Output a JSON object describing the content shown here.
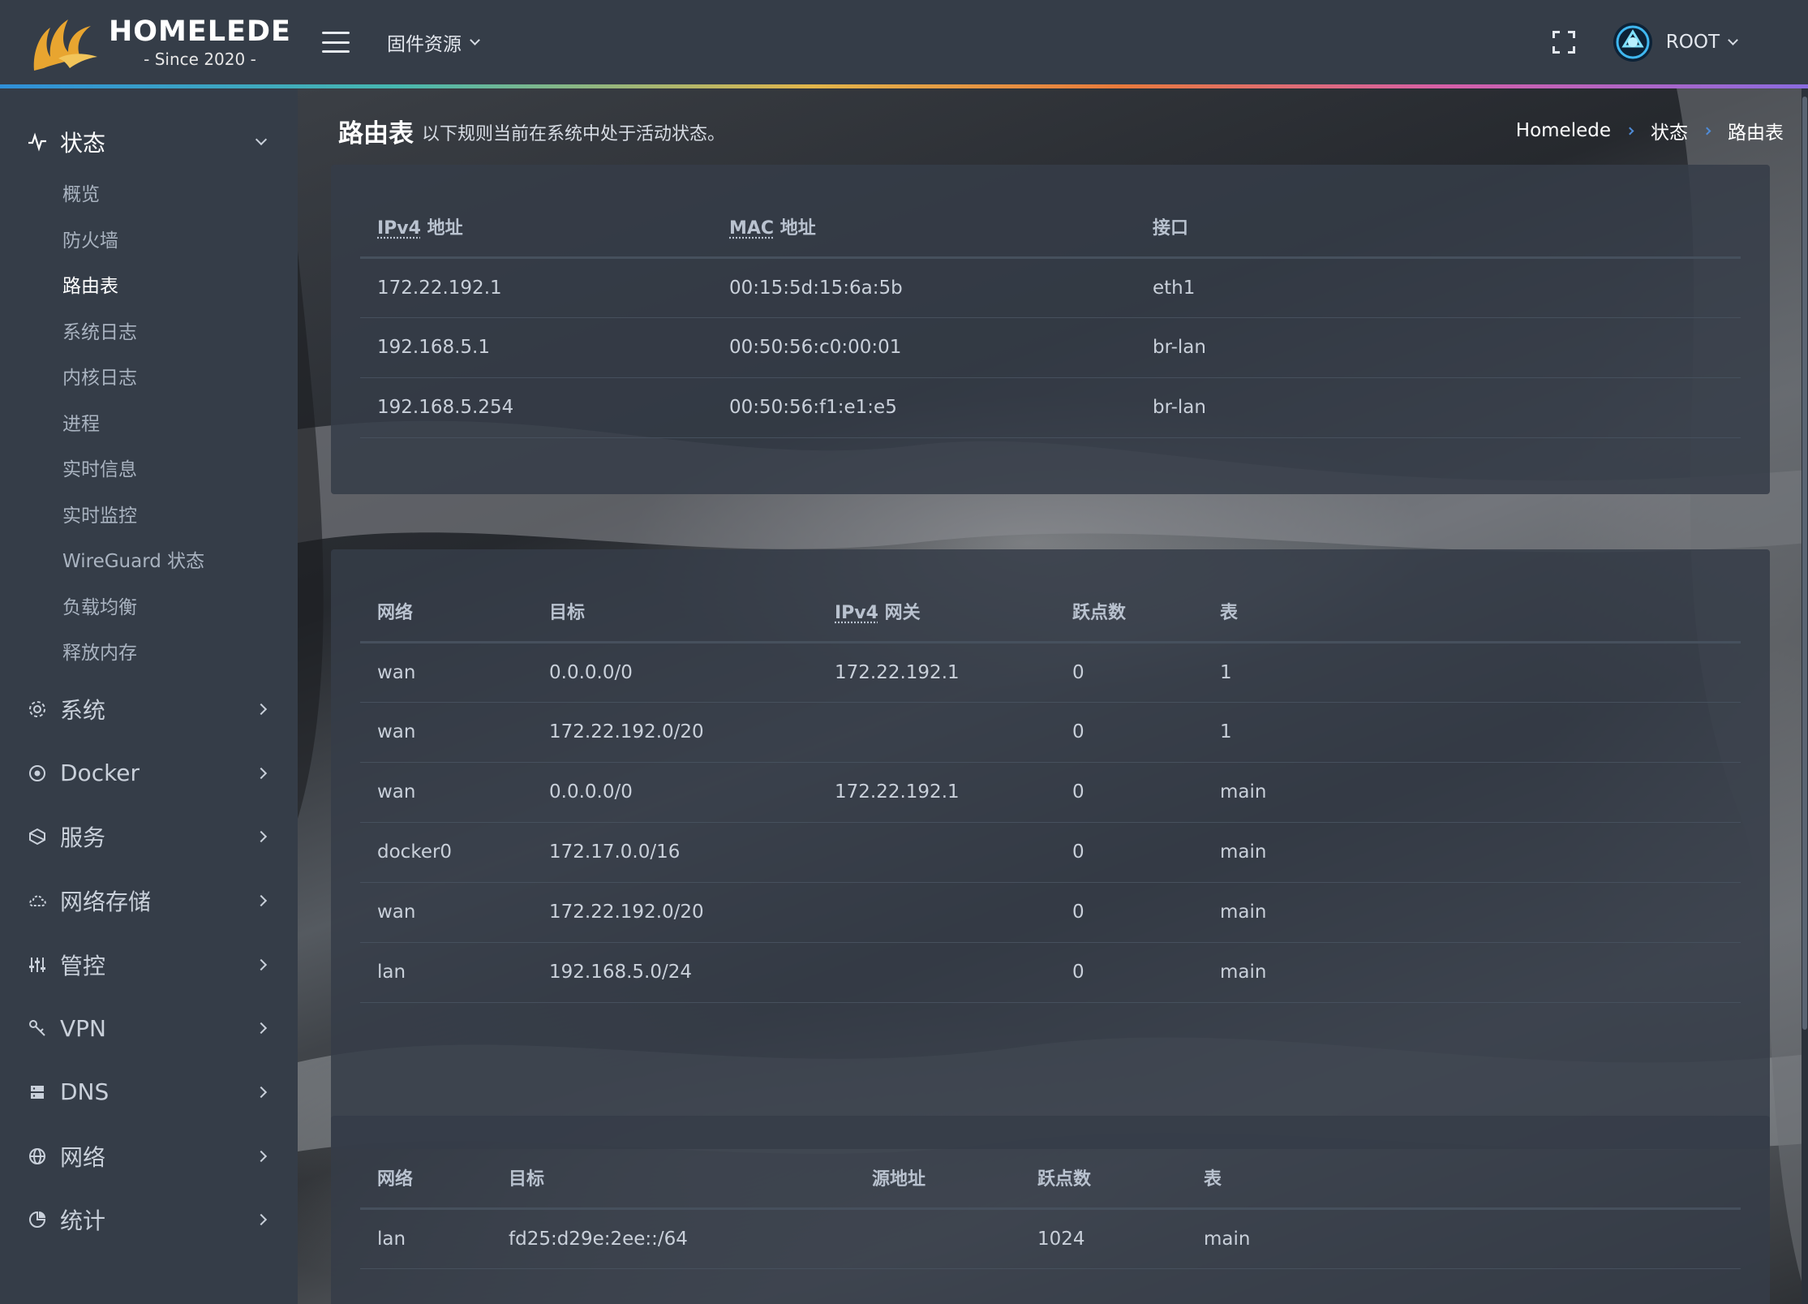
{
  "brand": {
    "name": "HOMELEDE",
    "since": "- Since 2020 -"
  },
  "header": {
    "firmware_menu": "固件资源",
    "user": "ROOT"
  },
  "sidebar": {
    "status": {
      "label": "状态",
      "items": [
        "概览",
        "防火墙",
        "路由表",
        "系统日志",
        "内核日志",
        "进程",
        "实时信息",
        "实时监控",
        "WireGuard 状态",
        "负载均衡",
        "释放内存"
      ],
      "active_index": 2
    },
    "groups": [
      {
        "label": "系统",
        "icon": "gear-icon"
      },
      {
        "label": "Docker",
        "icon": "docker-icon"
      },
      {
        "label": "服务",
        "icon": "services-icon"
      },
      {
        "label": "网络存储",
        "icon": "cloud-storage-icon"
      },
      {
        "label": "管控",
        "icon": "sliders-icon"
      },
      {
        "label": "VPN",
        "icon": "vpn-icon"
      },
      {
        "label": "DNS",
        "icon": "dns-icon"
      },
      {
        "label": "网络",
        "icon": "globe-icon"
      },
      {
        "label": "统计",
        "icon": "stats-icon"
      }
    ]
  },
  "page": {
    "title": "路由表",
    "description": "以下规则当前在系统中处于活动状态。",
    "breadcrumb": [
      "Homelede",
      "状态",
      "路由表"
    ]
  },
  "arp_table": {
    "headers": {
      "ip": "IPv4",
      "ip_suffix": " 地址",
      "mac": "MAC",
      "mac_suffix": " 地址",
      "iface": "接口"
    },
    "rows": [
      [
        "172.22.192.1",
        "00:15:5d:15:6a:5b",
        "eth1"
      ],
      [
        "192.168.5.1",
        "00:50:56:c0:00:01",
        "br-lan"
      ],
      [
        "192.168.5.254",
        "00:50:56:f1:e1:e5",
        "br-lan"
      ]
    ]
  },
  "ipv4_routes": {
    "headers": {
      "network": "网络",
      "target": "目标",
      "gw": "IPv4",
      "gw_suffix": " 网关",
      "metric": "跃点数",
      "table": "表"
    },
    "rows": [
      [
        "wan",
        "0.0.0.0/0",
        "172.22.192.1",
        "0",
        "1"
      ],
      [
        "wan",
        "172.22.192.0/20",
        "",
        "0",
        "1"
      ],
      [
        "wan",
        "0.0.0.0/0",
        "172.22.192.1",
        "0",
        "main"
      ],
      [
        "docker0",
        "172.17.0.0/16",
        "",
        "0",
        "main"
      ],
      [
        "wan",
        "172.22.192.0/20",
        "",
        "0",
        "main"
      ],
      [
        "lan",
        "192.168.5.0/24",
        "",
        "0",
        "main"
      ]
    ]
  },
  "ipv6_routes": {
    "headers": {
      "network": "网络",
      "target": "目标",
      "source": "源地址",
      "metric": "跃点数",
      "table": "表"
    },
    "rows": [
      [
        "lan",
        "fd25:d29e:2ee::/64",
        "",
        "1024",
        "main"
      ]
    ]
  },
  "colors": {
    "header_bg": "#353d48",
    "accent_blue": "#4f8bd6",
    "logo_gold": "#e8a530"
  }
}
